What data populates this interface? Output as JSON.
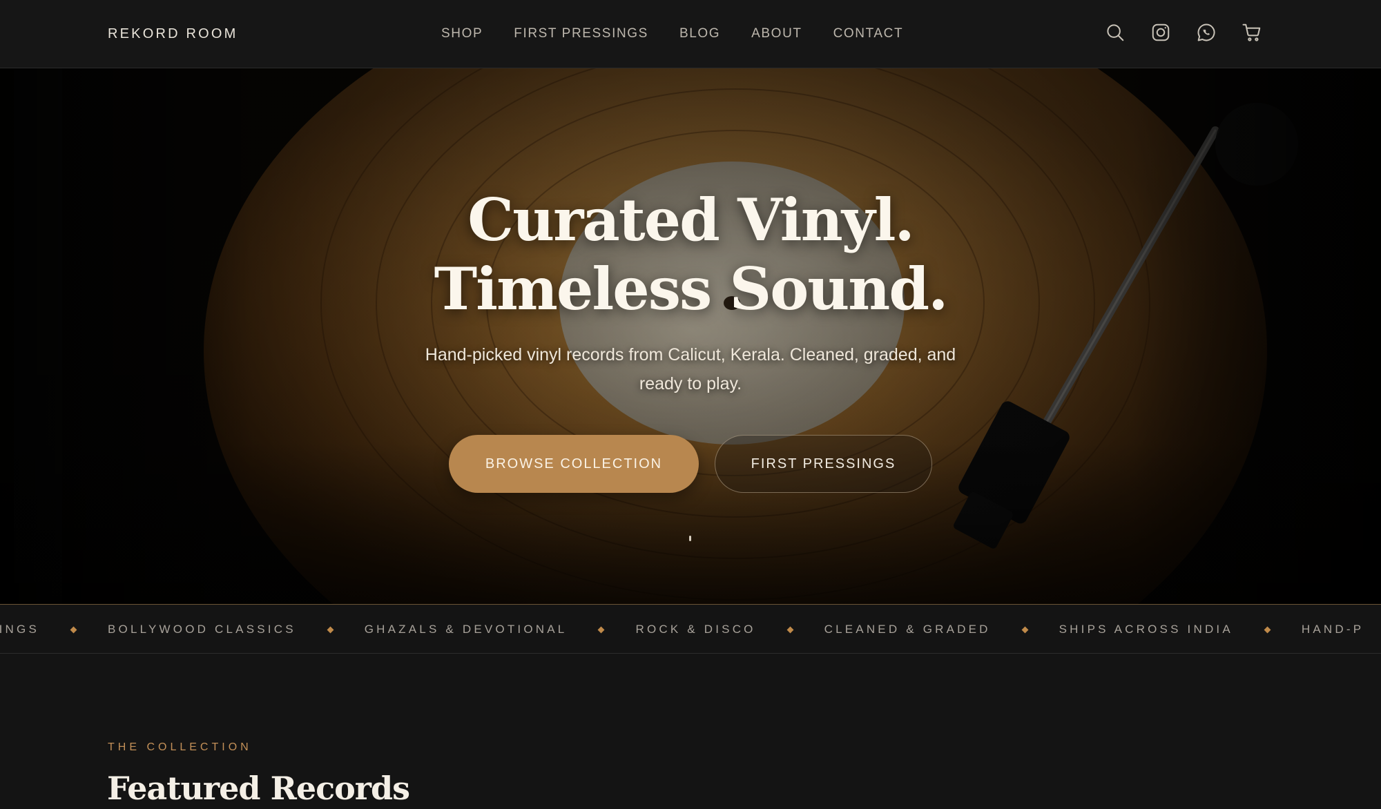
{
  "nav": {
    "brand": "REKORD ROOM",
    "links": [
      "SHOP",
      "FIRST PRESSINGS",
      "BLOG",
      "ABOUT",
      "CONTACT"
    ],
    "icons": [
      "search-icon",
      "instagram-icon",
      "whatsapp-icon",
      "cart-icon"
    ]
  },
  "hero": {
    "title_line1": "Curated Vinyl.",
    "title_line2": "Timeless Sound.",
    "subtitle": "Hand-picked vinyl records from Calicut, Kerala. Cleaned, graded, and ready to play.",
    "primary_button": "BROWSE COLLECTION",
    "secondary_button": "FIRST PRESSINGS"
  },
  "marquee": {
    "items": [
      "PRESSINGS",
      "BOLLYWOOD CLASSICS",
      "GHAZALS & DEVOTIONAL",
      "ROCK & DISCO",
      "CLEANED & GRADED",
      "SHIPS ACROSS INDIA",
      "HAND-P"
    ]
  },
  "collection": {
    "eyebrow": "THE COLLECTION",
    "title": "Featured Records"
  },
  "colors": {
    "accent": "#b8874f",
    "background": "#141414",
    "eyebrow": "#c39058"
  }
}
